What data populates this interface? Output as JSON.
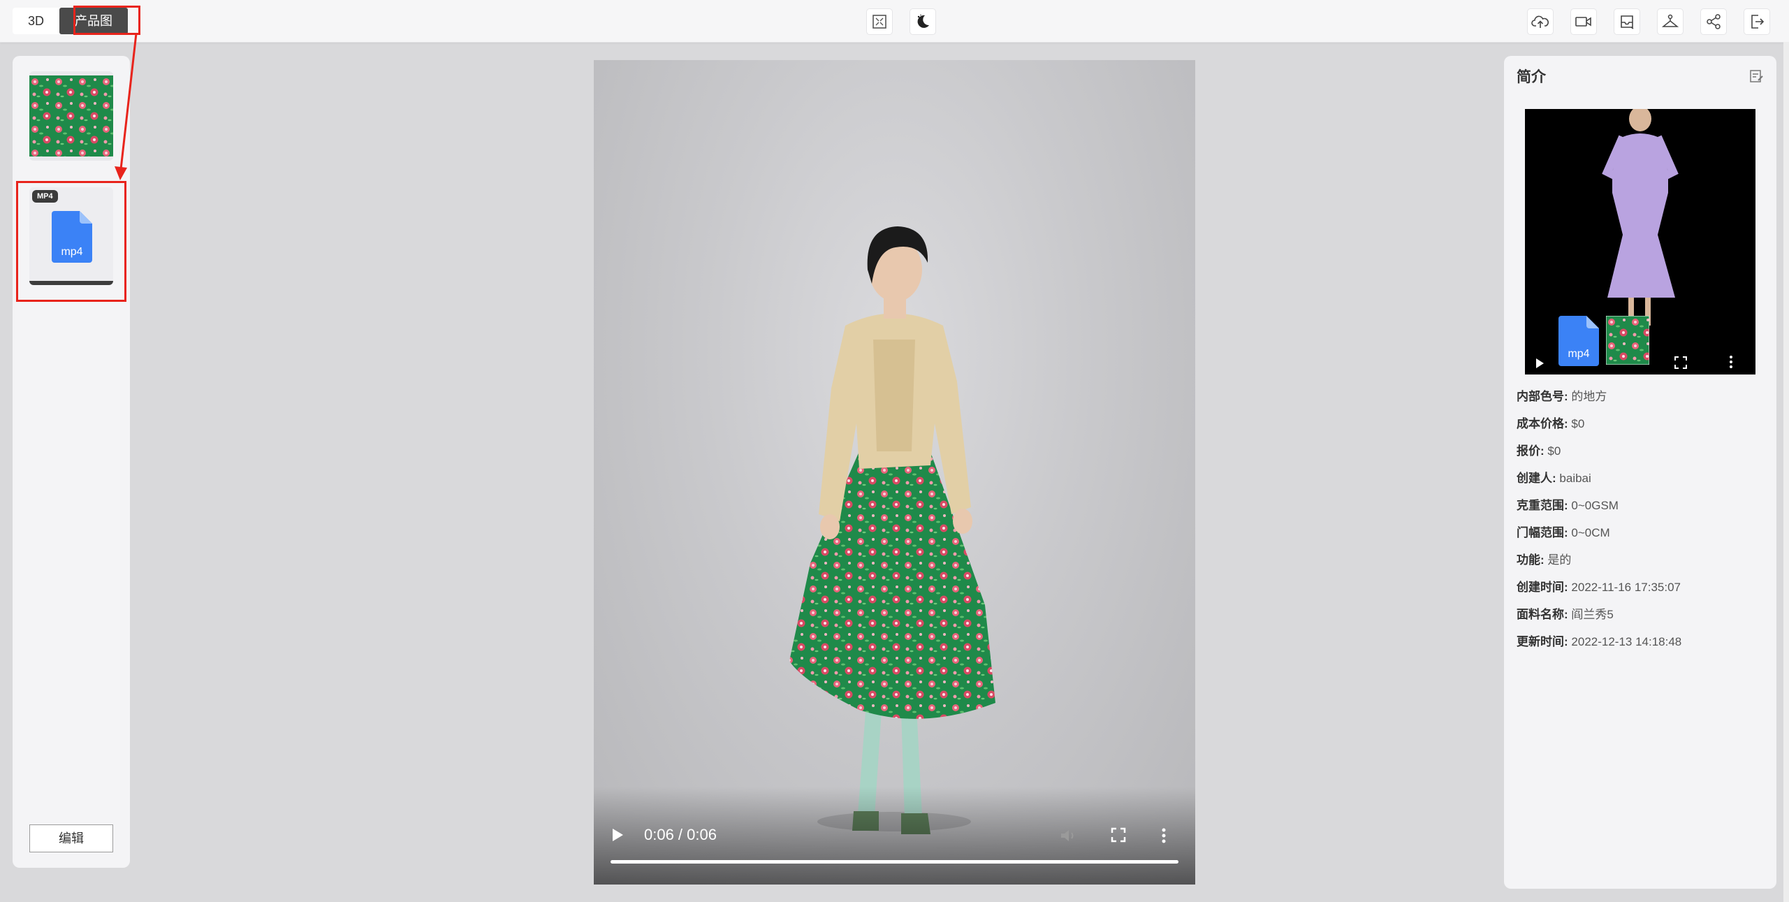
{
  "modes": {
    "three_d": "3D",
    "product": "产品图"
  },
  "left": {
    "thumb_badge": "MP4",
    "file_label": "mp4",
    "edit_label": "编辑"
  },
  "video": {
    "time": "0:06 / 0:06",
    "progress": 1.0
  },
  "panel": {
    "title": "简介",
    "preview_file_label": "mp4",
    "fields": [
      {
        "key": "内部色号:",
        "value": "的地方"
      },
      {
        "key": "成本价格:",
        "value": "$0"
      },
      {
        "key": "报价:",
        "value": "$0"
      },
      {
        "key": "创建人:",
        "value": "baibai"
      },
      {
        "key": "克重范围:",
        "value": "0~0GSM"
      },
      {
        "key": "门幅范围:",
        "value": "0~0CM"
      },
      {
        "key": "功能:",
        "value": "是的"
      },
      {
        "key": "创建时间:",
        "value": "2022-11-16 17:35:07"
      },
      {
        "key": "面料名称:",
        "value": "阎兰秀5"
      },
      {
        "key": "更新时间:",
        "value": "2022-12-13 14:18:48"
      }
    ]
  },
  "colors": {
    "accent_red": "#e8241c",
    "file_blue": "#3b82f6",
    "fabric_green": "#1f8a4a"
  },
  "icons": [
    "fullscreen-icon",
    "moon-icon",
    "cloud-upload-icon",
    "video-camera-icon",
    "inbox-icon",
    "hanger-icon",
    "share-icon",
    "exit-icon",
    "play-icon",
    "volume-icon",
    "more-icon",
    "edit-note-icon"
  ]
}
